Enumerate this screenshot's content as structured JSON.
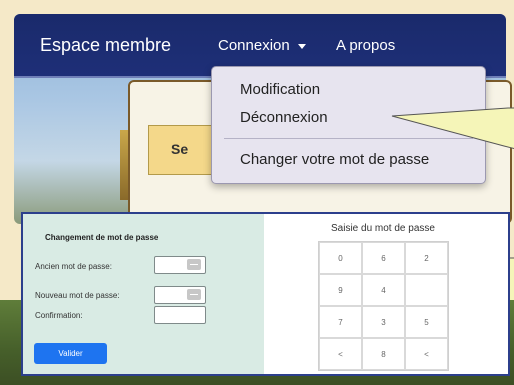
{
  "navbar": {
    "brand": "Espace membre",
    "connexion_label": "Connexion",
    "apropos_label": "A propos"
  },
  "dropdown": {
    "items": [
      "Modification",
      "Déconnexion",
      "Changer votre mot de passe"
    ]
  },
  "background_card": {
    "header_text": "Se"
  },
  "dialog": {
    "title": "Changement de mot de passe",
    "ancien_label": "Ancien mot de passe:",
    "nouveau_label": "Nouveau mot de passe:",
    "confirmation_label": "Confirmation:",
    "valider_label": "Valider",
    "keypad_title": "Saisie du mot de passe",
    "keypad_keys": [
      "0",
      "6",
      "2",
      "9",
      "4",
      "",
      "7",
      "3",
      "5",
      "<",
      "8",
      "<"
    ]
  },
  "colors": {
    "navbar": "#1e2f78",
    "dropdown_bg": "#e7e4ef",
    "callout_fill": "#f5f5b8",
    "left_pane": "#d9ebe4",
    "valider_button": "#1e74f0"
  }
}
